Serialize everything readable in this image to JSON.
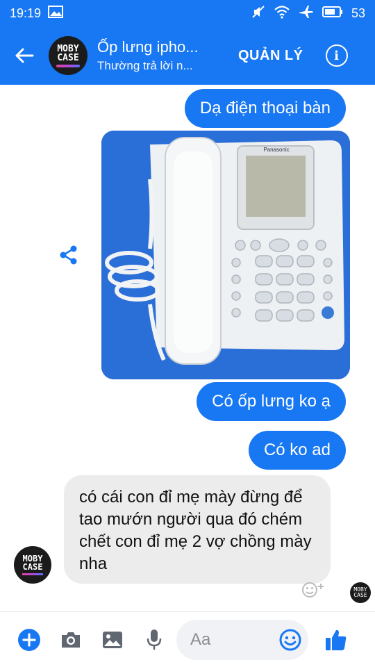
{
  "status_bar": {
    "time": "19:19",
    "battery": "53"
  },
  "header": {
    "title": "Ốp lưng ipho...",
    "subtitle": "Thường trả lời n...",
    "manage_label": "QUẢN LÝ",
    "avatar_line1": "MOBY",
    "avatar_line2": "CASE"
  },
  "messages": {
    "outgoing_1": "Dạ điện thoại bàn",
    "photo_brand": "Panasonic",
    "outgoing_2": "Có ốp lưng ko ạ",
    "outgoing_3": "Có ko ad",
    "incoming_1": "có cái con đỉ mẹ mày đừng để tao mướn người qua đó chém chết con đỉ mẹ 2 vợ chồng mày nha"
  },
  "composer": {
    "placeholder": "Aa"
  },
  "colors": {
    "brand": "#1877f2",
    "incoming_bubble": "#ececec"
  },
  "icons": [
    "gallery-icon",
    "mute-icon",
    "wifi-icon",
    "airplane-icon",
    "battery-icon",
    "back-arrow-icon",
    "info-icon",
    "share-icon",
    "add-icon",
    "camera-icon",
    "image-icon",
    "mic-icon",
    "emoji-icon",
    "like-icon"
  ]
}
